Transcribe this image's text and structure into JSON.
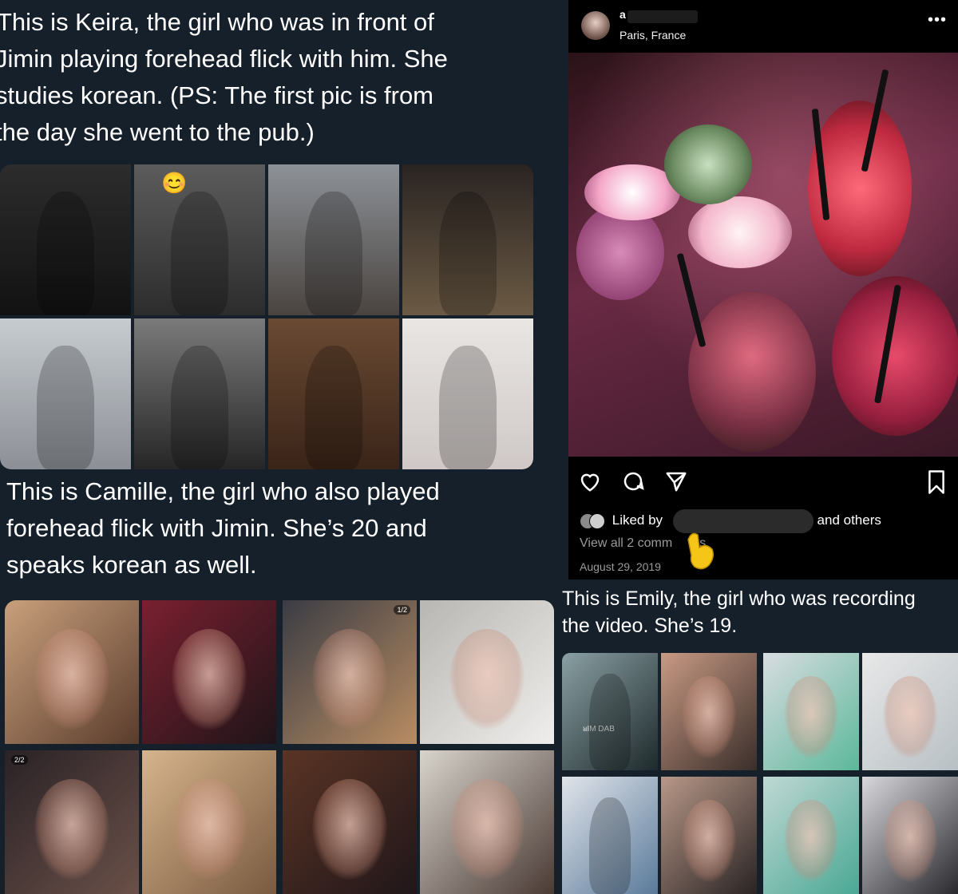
{
  "left_column": {
    "intro_text_lines": [
      "This is Keira, the girl who was in front of",
      "Jimin playing forehead flick with him. She",
      "studies korean. (PS: The first pic is from",
      "the day she went to the pub.)"
    ],
    "keira_grid": {
      "emoji": "😊"
    },
    "camille_text_lines": [
      "This is Camille, the girl who also played",
      "forehead flick with Jimin. She’s 20 and",
      "speaks korean as well."
    ],
    "camille_grid": {
      "badge_top": "1/2",
      "badge_bottom": "2/2"
    }
  },
  "right_column": {
    "instagram_post": {
      "username": "a t",
      "location": "Paris, France",
      "more_icon": "•••",
      "liked_by_prefix": "Liked by",
      "liked_by_suffix": "and others",
      "view_comments": "View all 2 comm",
      "view_comments_tail": "s",
      "date": "August 29, 2019",
      "icons": [
        "heart-icon",
        "comment-icon",
        "share-icon",
        "bookmark-icon"
      ]
    },
    "emily_text_lines": [
      "This is Emily, the girl who was recording",
      "the video. She’s 19."
    ],
    "shirt_text": "ᴚIM DAB"
  },
  "colors": {
    "background": "#15202b",
    "instagram_bg": "#000000",
    "text": "#ffffff",
    "muted": "#9a9a9a",
    "pointer_emoji": "#f5c518"
  }
}
